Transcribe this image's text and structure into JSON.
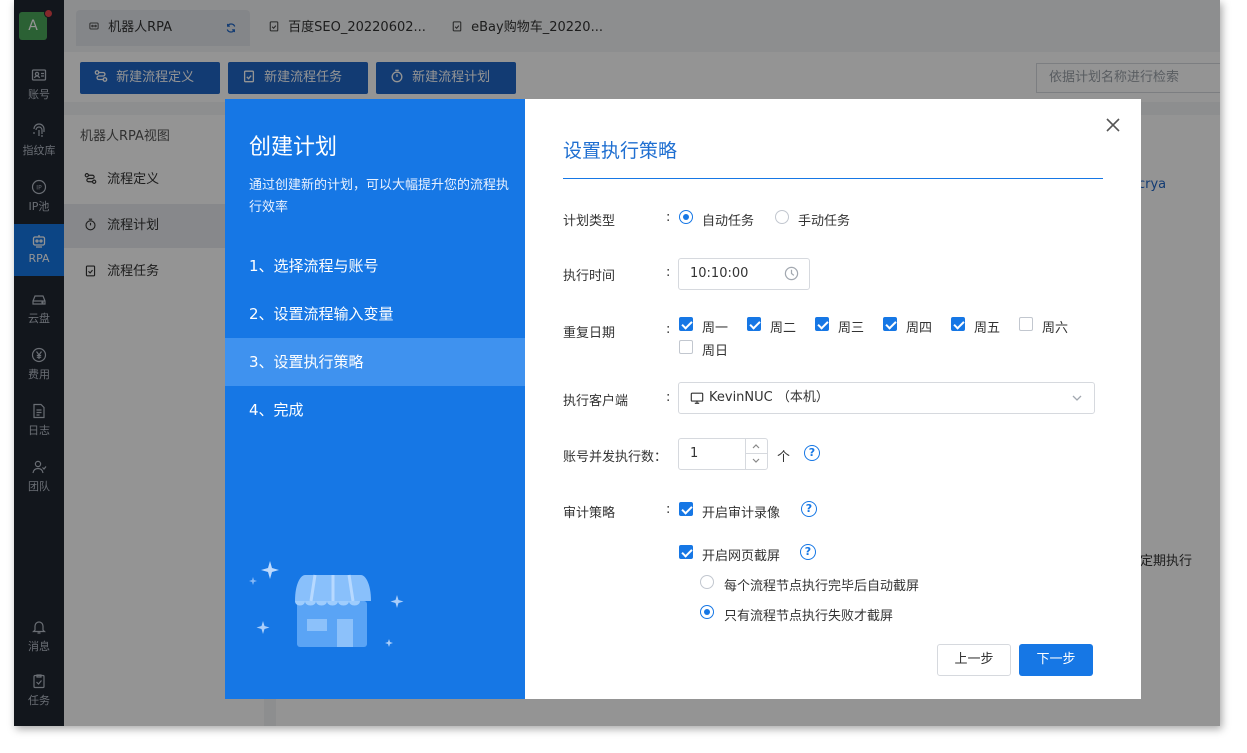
{
  "rail": {
    "avatar_letter": "A",
    "items": [
      {
        "label": "账号",
        "icon": "id-card-icon"
      },
      {
        "label": "指纹库",
        "icon": "fingerprint-icon"
      },
      {
        "label": "IP池",
        "icon": "ip-icon"
      },
      {
        "label": "RPA",
        "icon": "robot-icon",
        "active": true
      },
      {
        "label": "云盘",
        "icon": "cloud-drive-icon"
      },
      {
        "label": "费用",
        "icon": "yen-icon"
      },
      {
        "label": "日志",
        "icon": "log-icon"
      },
      {
        "label": "团队",
        "icon": "team-icon"
      },
      {
        "label": "消息",
        "icon": "bell-icon"
      },
      {
        "label": "任务",
        "icon": "task-icon"
      }
    ]
  },
  "tabs": [
    {
      "label": "机器人RPA",
      "active": true
    },
    {
      "label": "百度SEO_20220602..."
    },
    {
      "label": "eBay购物车_20220..."
    }
  ],
  "toolbar": {
    "new_flow_def": "新建流程定义",
    "new_flow_task": "新建流程任务",
    "new_flow_plan": "新建流程计划",
    "search_placeholder": "依据计划名称进行检索"
  },
  "sidenav": {
    "title": "机器人RPA视图",
    "items": [
      {
        "label": "流程定义"
      },
      {
        "label": "流程计划",
        "active": true
      },
      {
        "label": "流程任务"
      }
    ]
  },
  "background": {
    "link_fragment": "crya",
    "text_fragment": "定期执行"
  },
  "dialog": {
    "left": {
      "title": "创建计划",
      "subtitle": "通过创建新的计划，可以大幅提升您的流程执行效率",
      "steps": [
        {
          "label": "1、选择流程与账号"
        },
        {
          "label": "2、设置流程输入变量"
        },
        {
          "label": "3、设置执行策略",
          "active": true
        },
        {
          "label": "4、完成"
        }
      ]
    },
    "right": {
      "title": "设置执行策略",
      "plan_type": {
        "label": "计划类型",
        "options": [
          "自动任务",
          "手动任务"
        ],
        "selected": "自动任务"
      },
      "exec_time": {
        "label": "执行时间",
        "value": "10:10:00"
      },
      "repeat_days": {
        "label": "重复日期",
        "days": [
          {
            "label": "周一",
            "checked": true
          },
          {
            "label": "周二",
            "checked": true
          },
          {
            "label": "周三",
            "checked": true
          },
          {
            "label": "周四",
            "checked": true
          },
          {
            "label": "周五",
            "checked": true
          },
          {
            "label": "周六",
            "checked": false
          },
          {
            "label": "周日",
            "checked": false
          }
        ]
      },
      "client": {
        "label": "执行客户端",
        "value": "KevinNUC （本机）"
      },
      "concurrency": {
        "label": "账号并发执行数：",
        "value": "1",
        "unit": "个"
      },
      "audit": {
        "label": "审计策略",
        "record_video": {
          "label": "开启审计录像",
          "checked": true
        },
        "web_screenshot": {
          "label": "开启网页截屏",
          "checked": true
        },
        "screenshot_modes": [
          {
            "label": "每个流程节点执行完毕后自动截屏",
            "selected": false
          },
          {
            "label": "只有流程节点执行失败才截屏",
            "selected": true
          }
        ]
      },
      "prev_button": "上一步",
      "next_button": "下一步"
    }
  }
}
